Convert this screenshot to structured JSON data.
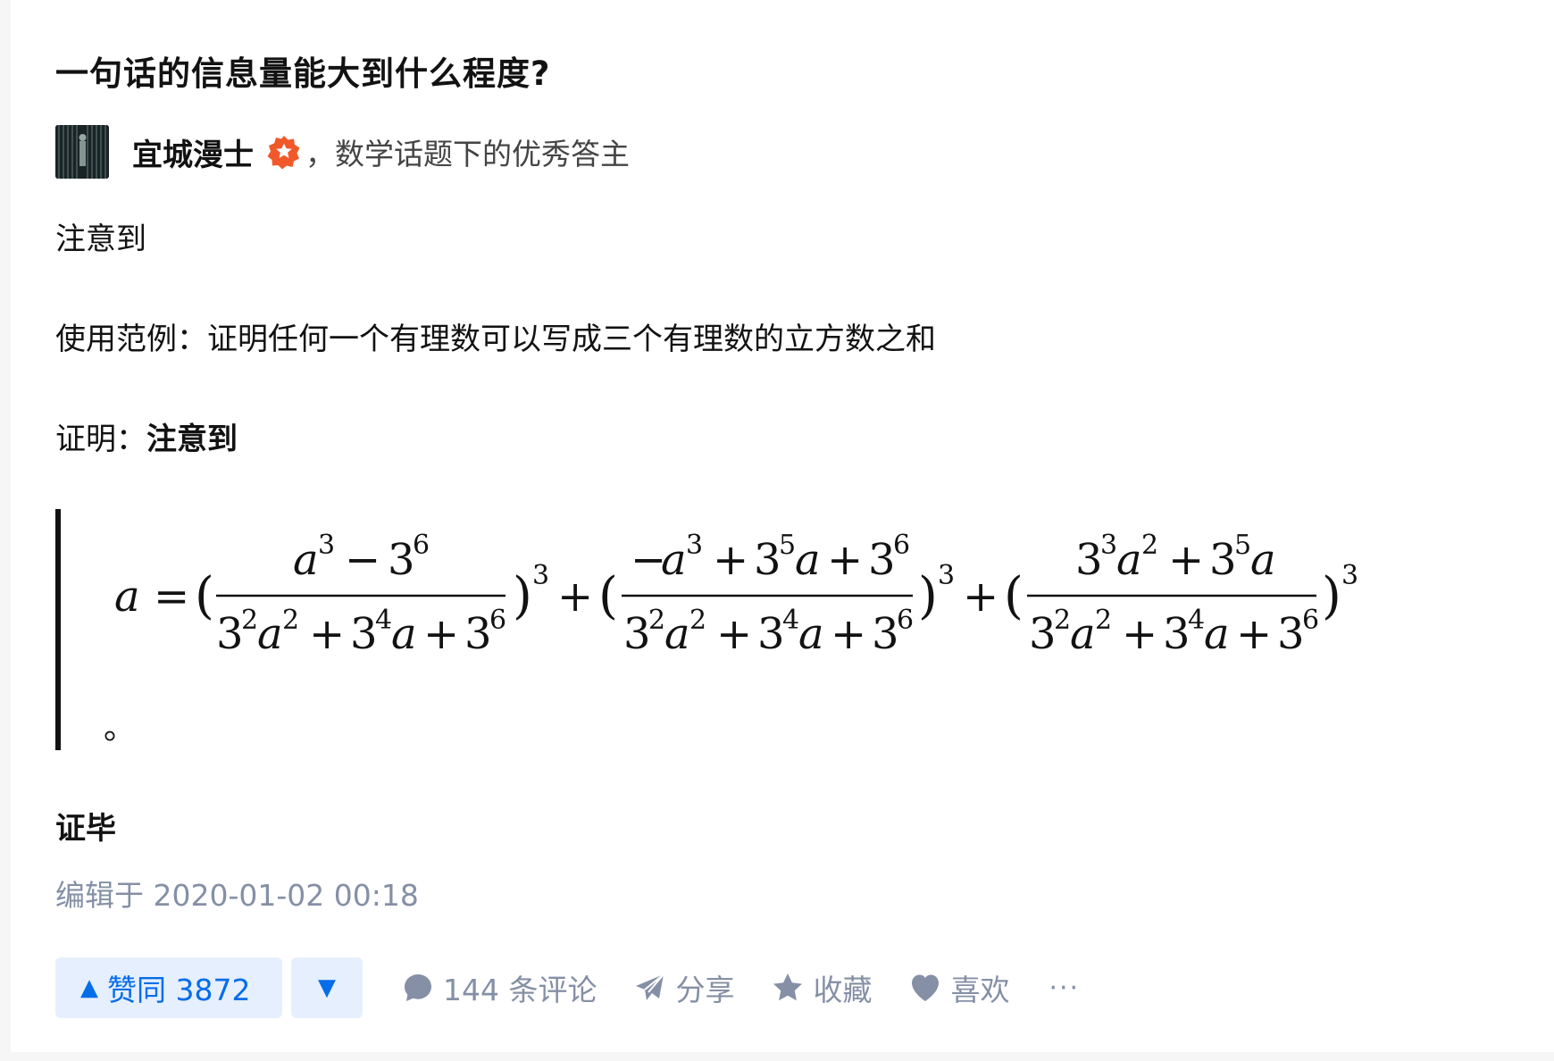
{
  "question": {
    "title": "一句话的信息量能大到什么程度?"
  },
  "author": {
    "name": "宜城漫士",
    "badge_icon": "excellent-answerer-badge-icon",
    "description": "，数学话题下的优秀答主"
  },
  "content": {
    "p1": "注意到",
    "p2": "使用范例：证明任何一个有理数可以写成三个有理数的立方数之和",
    "p3_prefix": "证明：",
    "p3_bold": "注意到",
    "formula_period": "。",
    "p4": "证毕"
  },
  "formula": {
    "lhs": "a",
    "eq": "=",
    "plus": "+",
    "term1_num": "a³ − 3⁶",
    "term2_num": "−a³ + 3⁵a + 3⁶",
    "term3_num": "3³a² + 3⁵a",
    "denominator": "3²a² + 3⁴a + 3⁶",
    "outer_exponent": "3"
  },
  "meta": {
    "edited": "编辑于 2020-01-02 00:18"
  },
  "actions": {
    "vote_up_icon": "▲",
    "vote_up_label": "赞同 3872",
    "vote_down_icon": "▼",
    "comment_label": "144 条评论",
    "share_label": "分享",
    "favorite_label": "收藏",
    "like_label": "喜欢",
    "more_label": "···"
  },
  "colors": {
    "accent": "#056de8",
    "vote_bg": "#e6effd",
    "muted": "#8590a6",
    "badge": "#f1592a"
  }
}
